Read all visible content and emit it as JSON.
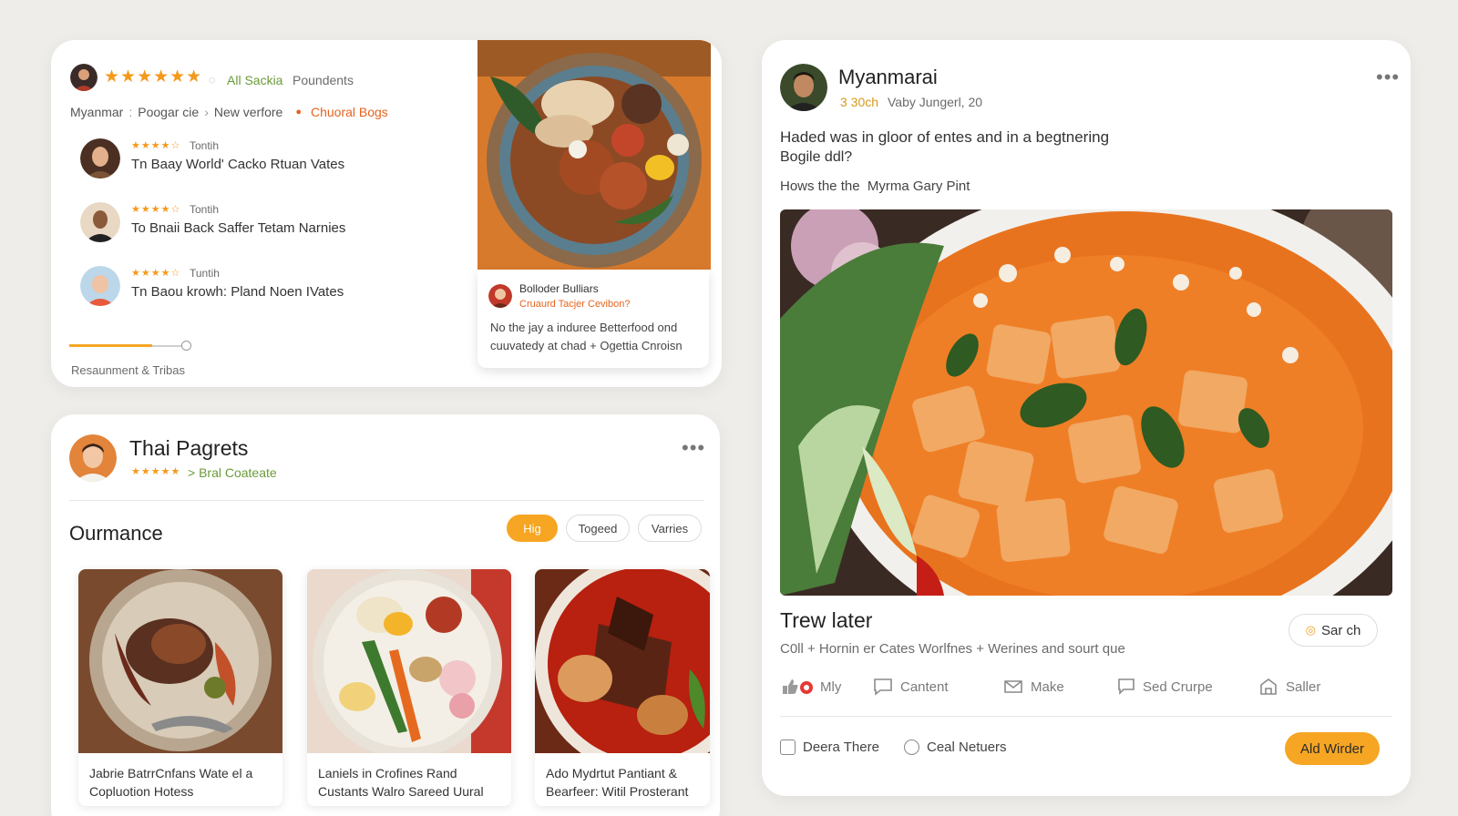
{
  "review_card": {
    "rating_stars": "★★★★★★",
    "rating_link": "All Sackia",
    "rating_suffix": "Poundents",
    "breadcrumb": [
      "Myanmar",
      "Poogar cie",
      "New verfore"
    ],
    "location_tag": "Chuoral Bogs",
    "reviews": [
      {
        "stars": "★★★★☆",
        "author": "Tontih",
        "title": "Tn Baay World' Cacko Rtuan Vates"
      },
      {
        "stars": "★★★★☆",
        "author": "Tontih",
        "title": "To Bnaii Back Saffer Tetam Narnies"
      },
      {
        "stars": "★★★★☆",
        "author": "Tuntih",
        "title": "Tn Baou krowh: Pland Noen IVates"
      }
    ],
    "progress_fraction": 0.69,
    "footer_label": "Resaunment & Tribas",
    "popup": {
      "author": "Bolloder Bulliars",
      "subtitle": "Cruaurd Tacjer Cevibon?",
      "text_line1": "No the jay a induree Betterfood ond",
      "text_line2": "cuuvatedy at chad + Ogettia Cnroisn"
    }
  },
  "thai_card": {
    "name": "Thai Pagrets",
    "rating_stars": "★★★★★",
    "rating_link": "> Bral Coateate",
    "section_title": "Ourmance",
    "filters": [
      {
        "label": "Hig",
        "active": true
      },
      {
        "label": "Togeed",
        "active": false
      },
      {
        "label": "Varries",
        "active": false
      }
    ],
    "dishes": [
      {
        "caption1": "Jabrie BatrrCnfans Wate el a",
        "caption2": "Copluotion Hotess"
      },
      {
        "caption1": "Laniels in Crofines Rand",
        "caption2": "Custants Walro Sareed Uural"
      },
      {
        "caption1": "Ado Mydrtut Pantiant &",
        "caption2": "Bearfeer: Witil Prosterant"
      }
    ]
  },
  "post_card": {
    "name": "Myanmarai",
    "meta_highlight": "3 30ch",
    "meta_rest": "Vaby Jungerl, 20",
    "body_line1": "Haded was in gloor of entes and in a begtnering",
    "body_line2": "Bogile ddl?",
    "subline": "Hows the the  Myrma Gary Pint",
    "title": "Trew later",
    "search_button": "Sar ch",
    "tags_line": "C0ll + Hornin er Cates Worlfnes + Werines and sourt que",
    "actions": [
      {
        "icon": "like-icon",
        "label": "Mly"
      },
      {
        "icon": "comment-icon",
        "label": "Cantent"
      },
      {
        "icon": "message-icon",
        "label": "Make"
      },
      {
        "icon": "chat-icon",
        "label": "Sed Crurpe"
      },
      {
        "icon": "store-icon",
        "label": "Saller"
      }
    ],
    "checkbox_label": "Deera There",
    "radio_label": "Ceal Netuers",
    "primary_button": "Ald Wirder"
  },
  "colors": {
    "accent": "#f6a623",
    "star": "#f39a1c",
    "link_green": "#6c9a3a",
    "link_orange": "#e5631f",
    "background": "#efedea"
  }
}
